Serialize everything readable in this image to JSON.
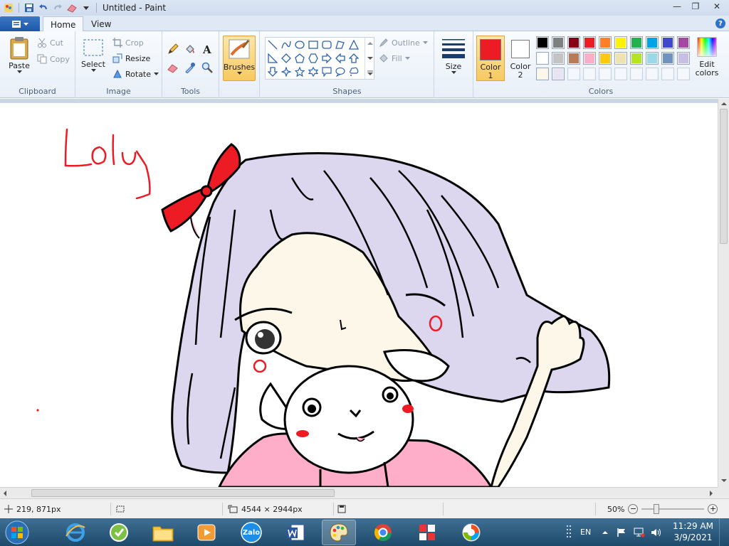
{
  "window": {
    "title": "Untitled - Paint",
    "controls": {
      "minimize": "—",
      "maximize": "❐",
      "close": "✕"
    }
  },
  "ribbon_tabs": {
    "home": "Home",
    "view": "View",
    "help": "?"
  },
  "clipboard": {
    "label": "Clipboard",
    "paste": "Paste",
    "cut": "Cut",
    "copy": "Copy"
  },
  "image": {
    "label": "Image",
    "select": "Select",
    "crop": "Crop",
    "resize": "Resize",
    "rotate": "Rotate"
  },
  "tools": {
    "label": "Tools"
  },
  "brushes": {
    "label": "Brushes"
  },
  "shapes": {
    "label": "Shapes",
    "outline": "Outline",
    "fill": "Fill"
  },
  "size": {
    "label": "Size"
  },
  "colors": {
    "label": "Colors",
    "color1_label_line1": "Color",
    "color1_label_line2": "1",
    "color2_label_line1": "Color",
    "color2_label_line2": "2",
    "edit_line1": "Edit",
    "edit_line2": "colors",
    "color1": "#ed1c24",
    "color2": "#ffffff",
    "palette": [
      "#000000",
      "#7f7f7f",
      "#880015",
      "#ed1c24",
      "#ff7f27",
      "#fff200",
      "#22b14c",
      "#00a2e8",
      "#3f48cc",
      "#a349a4",
      "#ffffff",
      "#c3c3c3",
      "#b97a57",
      "#ffaec9",
      "#ffc90e",
      "#efe4b0",
      "#b5e61d",
      "#99d9ea",
      "#7092be",
      "#c8bfe7",
      "#fcf7e8",
      "#e8e4f4",
      "",
      "",
      "",
      "",
      "",
      "",
      "",
      ""
    ]
  },
  "canvas": {
    "handwritten_text": "Loly"
  },
  "status": {
    "cursor_pos": "219, 871px",
    "image_size": "4544 × 2944px",
    "zoom": "50%",
    "zoom_minus": "−",
    "zoom_plus": "+"
  },
  "taskbar": {
    "zalo_label": "Zalo",
    "lang": "EN",
    "time": "11:29 AM",
    "date": "3/9/2021"
  }
}
